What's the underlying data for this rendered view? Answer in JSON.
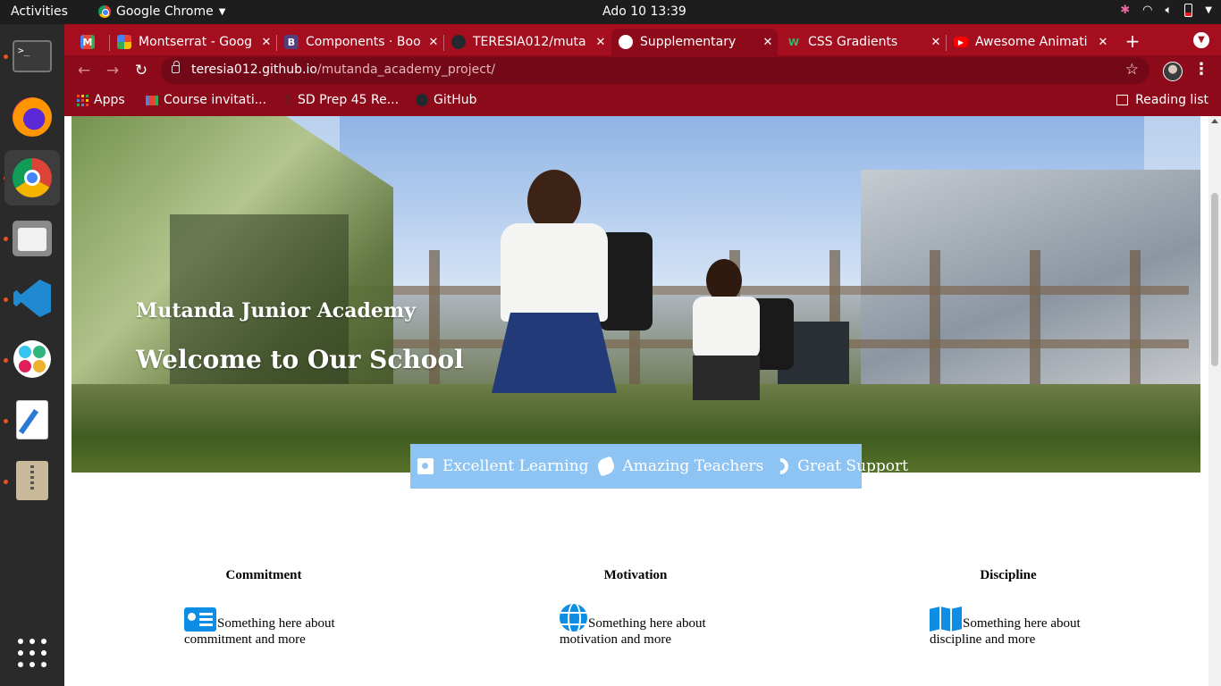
{
  "system": {
    "activities": "Activities",
    "app_name": "Google Chrome",
    "clock": "Ado 10  13:39"
  },
  "dock": {
    "items": [
      "terminal-icon",
      "firefox-icon",
      "chrome-icon",
      "files-icon",
      "vscode-icon",
      "slack-icon",
      "text-editor-icon",
      "archive-manager-icon"
    ],
    "show_apps": "show-applications-icon"
  },
  "browser": {
    "tabs": [
      {
        "title": "",
        "favicon": "gmail-icon",
        "active": false
      },
      {
        "title": "Montserrat - Goog",
        "favicon": "google-fonts-icon",
        "active": false
      },
      {
        "title": "Components · Boo",
        "favicon": "bootstrap-icon",
        "active": false
      },
      {
        "title": "TERESIA012/muta",
        "favicon": "github-icon",
        "active": false
      },
      {
        "title": "Supplementary",
        "favicon": "globe-icon",
        "active": true
      },
      {
        "title": "CSS Gradients",
        "favicon": "w-icon",
        "active": false
      },
      {
        "title": "Awesome Animati",
        "favicon": "youtube-icon",
        "active": false
      }
    ],
    "url_host": "teresia012.github.io",
    "url_path": "/mutanda_academy_project/",
    "bookmarks": [
      {
        "label": "Apps",
        "icon": "apps-grid-icon"
      },
      {
        "label": "Course invitati...",
        "icon": "gmail-icon"
      },
      {
        "label": "SD Prep 45 Re...",
        "icon": "microverse-icon"
      },
      {
        "label": "GitHub",
        "icon": "github-icon"
      }
    ],
    "reading_list": "Reading list",
    "accent": "#a50e1f"
  },
  "page": {
    "hero": {
      "subtitle": "Mutanda Junior Academy",
      "title": "Welcome to Our School"
    },
    "features": [
      {
        "label": "Excellent Learning",
        "icon": "address-book-icon"
      },
      {
        "label": "Amazing Teachers",
        "icon": "handshake-icon"
      },
      {
        "label": "Great Support",
        "icon": "phone-icon"
      }
    ],
    "features_bg": "#8ec4f3",
    "columns": [
      {
        "title": "Commitment",
        "text": "Something here about commitment and more",
        "icon": "id-card-icon"
      },
      {
        "title": "Motivation",
        "text": "Something here about motivation and more",
        "icon": "globe-icon"
      },
      {
        "title": "Discipline",
        "text": "Something here about discipline and more",
        "icon": "map-icon"
      }
    ],
    "icon_color": "#0d8de3"
  }
}
